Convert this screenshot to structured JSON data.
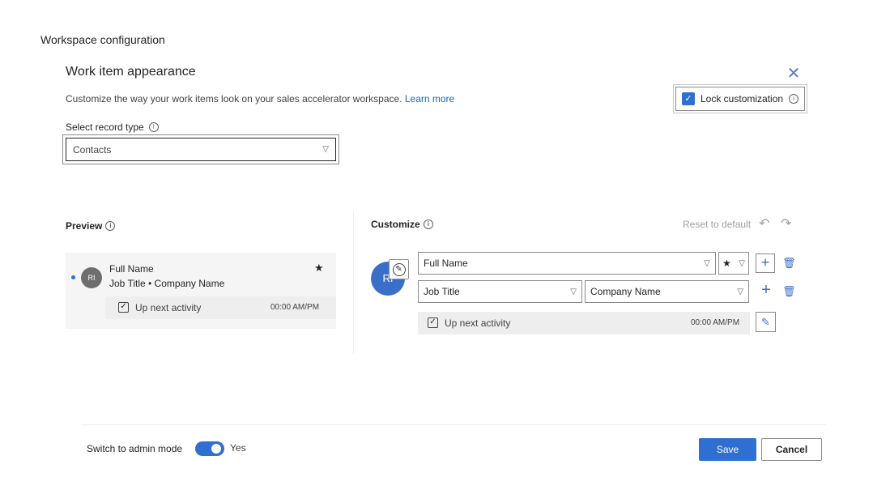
{
  "window": {
    "title": "Workspace configuration"
  },
  "panel": {
    "title": "Work item appearance",
    "description": "Customize the way your work items look on your sales accelerator workspace.",
    "learn_more": "Learn more",
    "close_icon": "close-icon"
  },
  "lock": {
    "label": "Lock customization",
    "checked": true
  },
  "record_type": {
    "label": "Select record type",
    "value": "Contacts"
  },
  "preview": {
    "label": "Preview",
    "avatar_initials": "RI",
    "primary": "Full Name",
    "secondary": "Job Title • Company Name",
    "activity": "Up next activity",
    "time": "00:00 AM/PM"
  },
  "customize": {
    "label": "Customize",
    "reset": "Reset to default",
    "avatar_initials": "RI",
    "field_primary": "Full Name",
    "field_job": "Job Title",
    "field_company": "Company Name",
    "star": "★",
    "activity": "Up next activity",
    "time": "00:00 AM/PM"
  },
  "footer": {
    "admin_label": "Switch to admin mode",
    "admin_state": "Yes",
    "save": "Save",
    "cancel": "Cancel"
  },
  "colors": {
    "accent": "#2f6fd0",
    "link": "#0f6cbd"
  }
}
